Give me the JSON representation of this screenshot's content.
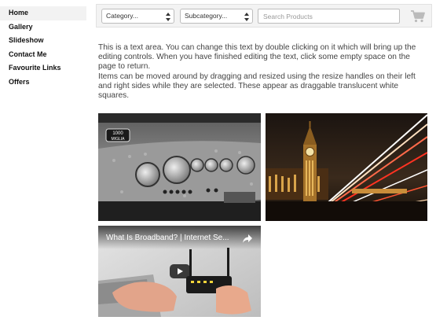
{
  "sidebar": {
    "items": [
      {
        "label": "Home",
        "active": true
      },
      {
        "label": "Gallery"
      },
      {
        "label": "Slideshow"
      },
      {
        "label": "Contact Me"
      },
      {
        "label": "Favourite Links"
      },
      {
        "label": "Offers"
      }
    ]
  },
  "filters": {
    "category": "Category...",
    "subcategory": "Subcategory...",
    "search_placeholder": "Search Products",
    "cart_icon": "cart-icon"
  },
  "text_area": {
    "paragraph1": "This is a text area. You can change this text by double clicking on it which will bring up the editing controls. When you have finished editing the text, click some empty space on the page to return.",
    "paragraph2": "Items can be moved around by dragging and resized using the resize handles on their left and right sides while they are selected. These appear as draggable translucent white squares."
  },
  "video": {
    "title": "What Is Broadband? | Internet Se...",
    "share_icon": "share-icon",
    "play_icon": "play-icon"
  },
  "colors": {
    "accent_bg": "#f3f3f3",
    "active_nav": "#f2f2f2"
  }
}
